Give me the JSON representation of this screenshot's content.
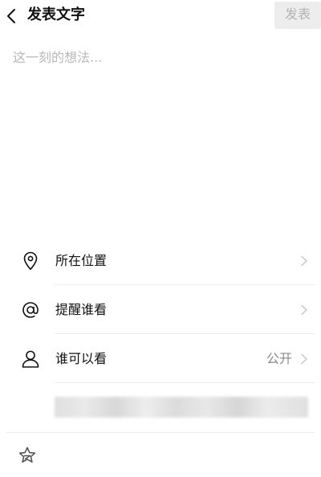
{
  "header": {
    "title": "发表文字",
    "back_icon": "chevron-left-icon",
    "publish_label": "发表"
  },
  "compose": {
    "placeholder": "这一刻的想法...",
    "value": ""
  },
  "options": [
    {
      "icon": "location-pin-icon",
      "label": "所在位置",
      "value": ""
    },
    {
      "icon": "at-icon",
      "label": "提醒谁看",
      "value": ""
    },
    {
      "icon": "person-icon",
      "label": "谁可以看",
      "value": "公开"
    }
  ],
  "bottom": {
    "icon": "star-icon"
  },
  "colors": {
    "publish_bg": "#ededed",
    "publish_text": "#b2b2b2",
    "placeholder": "#b8b8b8",
    "secondary_text": "#8a8a8a",
    "divider": "#ececec"
  }
}
